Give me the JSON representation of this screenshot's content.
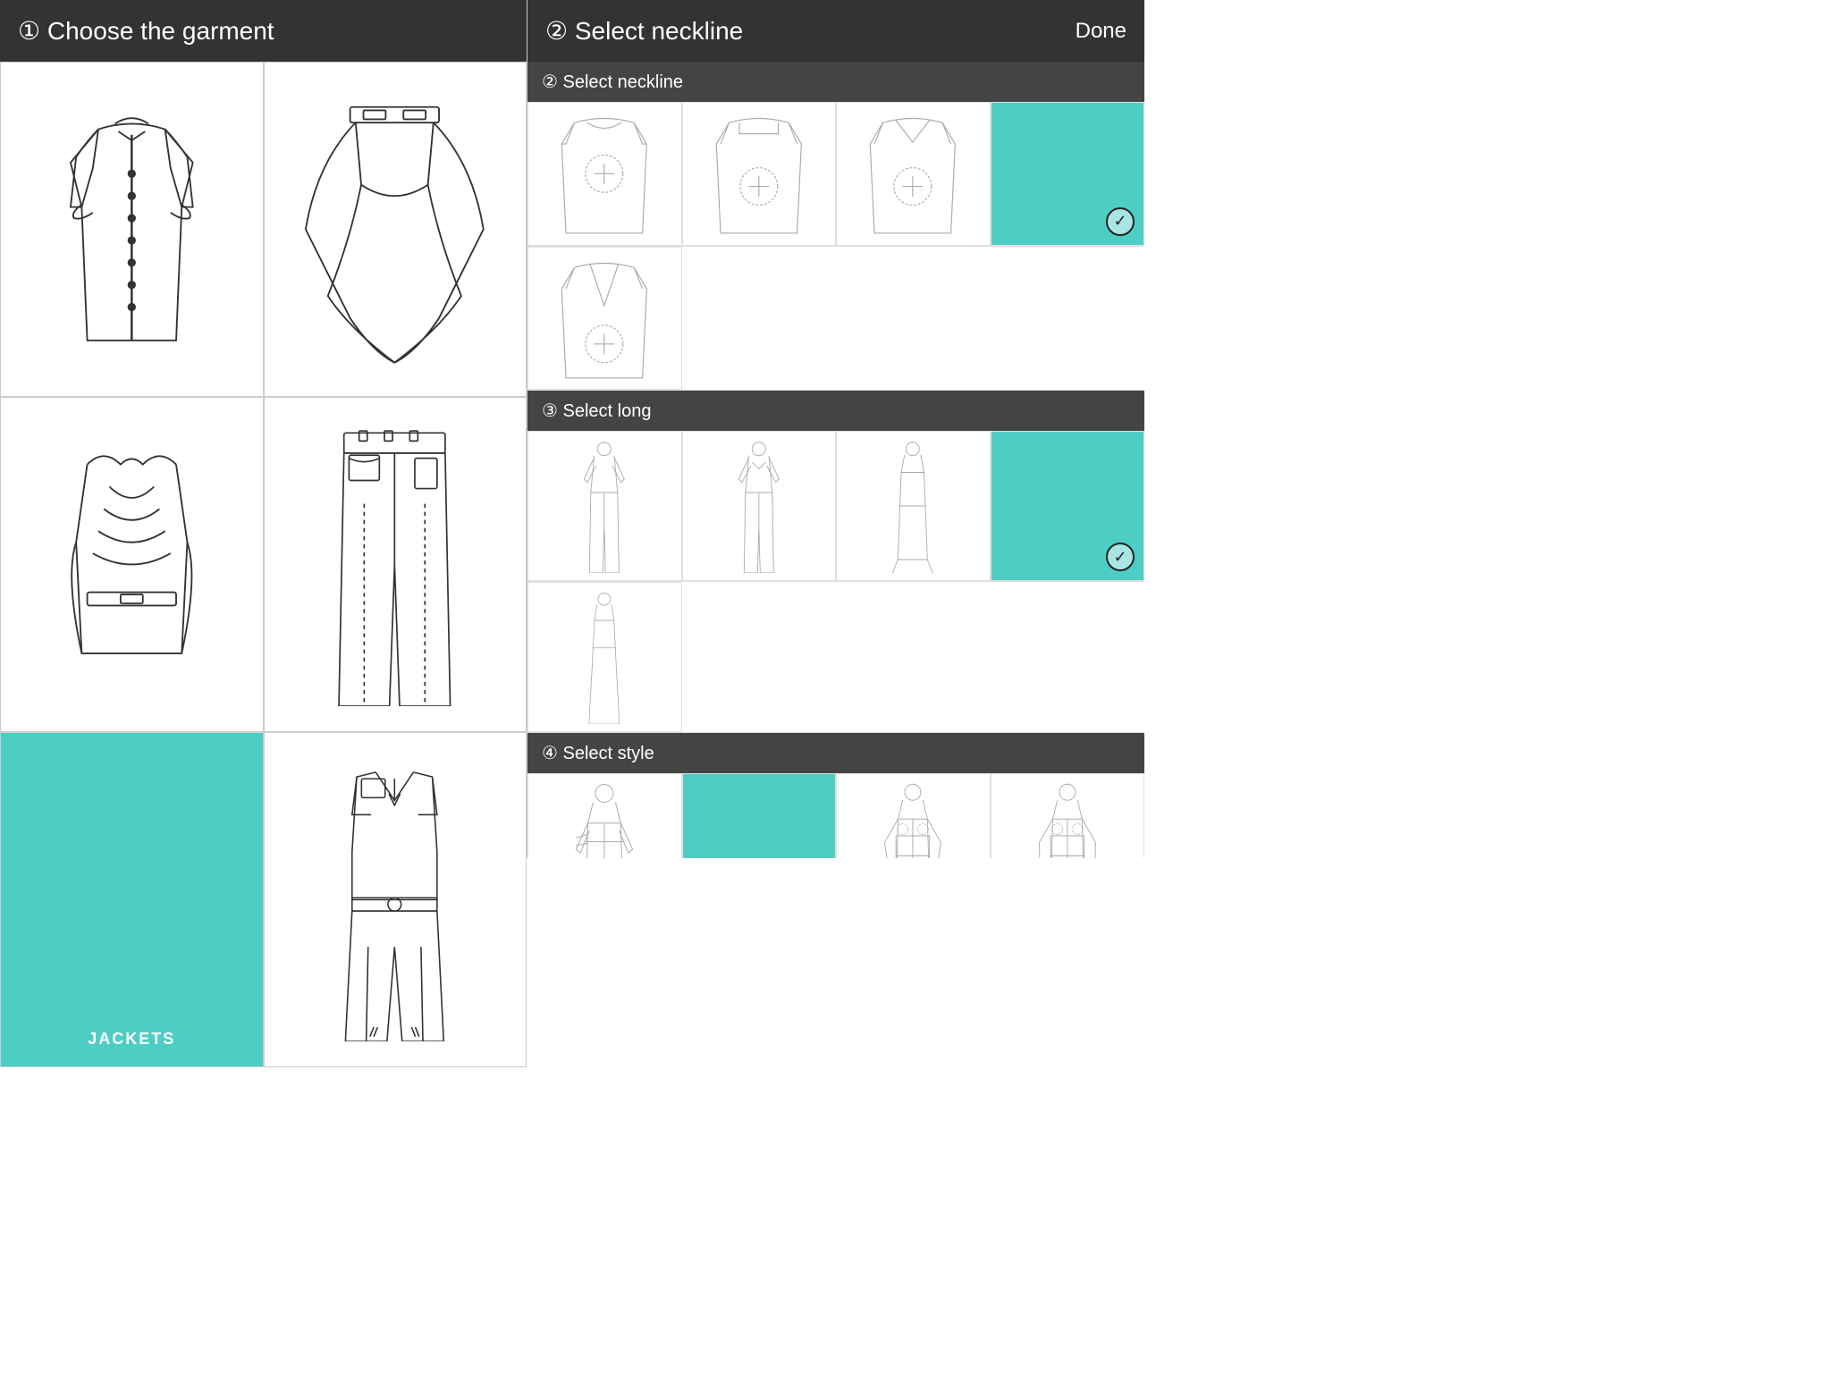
{
  "left": {
    "header": "① Choose the garment",
    "garments": [
      {
        "id": "blouse",
        "label": "",
        "selected": false
      },
      {
        "id": "asymmetric-top",
        "label": "",
        "selected": false
      },
      {
        "id": "corset",
        "label": "",
        "selected": false
      },
      {
        "id": "trousers",
        "label": "",
        "selected": false
      },
      {
        "id": "jacket",
        "label": "JACKETS",
        "selected": true
      },
      {
        "id": "jumpsuit",
        "label": "",
        "selected": false
      }
    ]
  },
  "right": {
    "header": "② Select neckline",
    "done_label": "Done",
    "sections": [
      {
        "id": "neckline",
        "label": "② Select neckline",
        "options_row1": [
          "round",
          "crew",
          "v-neck",
          "turtleneck"
        ],
        "options_row2": [
          "deep-v"
        ],
        "selected": "turtleneck"
      },
      {
        "id": "length",
        "label": "③ Select long",
        "options_row1": [
          "long-with-pants",
          "back-view-long",
          "sleeveless-long",
          "sleeveless-short"
        ],
        "options_row2": [
          "sleeveless-dress"
        ],
        "selected": "sleeveless-short"
      },
      {
        "id": "style",
        "label": "④ Select style",
        "options": [
          "style1",
          "style2-selected",
          "style3",
          "style4"
        ],
        "selected": "style2-selected"
      }
    ]
  }
}
